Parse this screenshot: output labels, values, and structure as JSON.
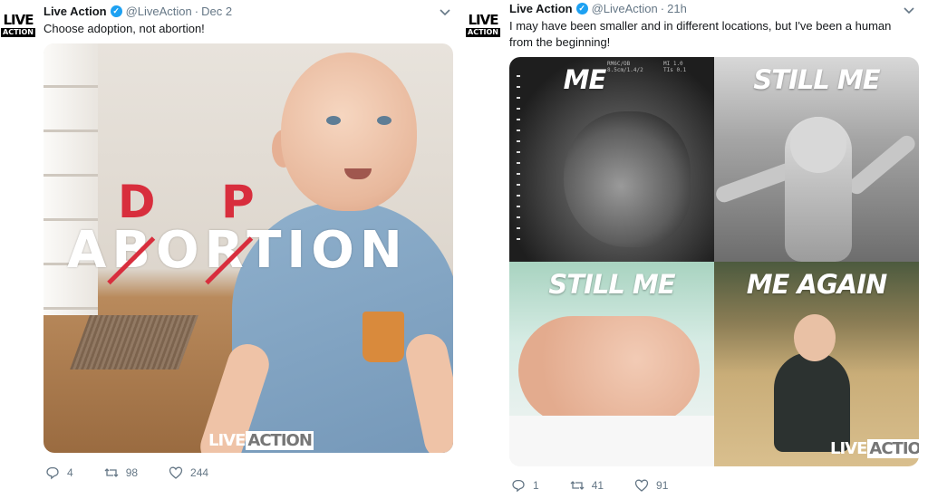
{
  "tweets": [
    {
      "avatar": {
        "line1": "LIVE",
        "line2": "ACTION"
      },
      "name": "Live Action",
      "handle": "@LiveAction",
      "time": "Dec 2",
      "text": "Choose adoption, not abortion!",
      "image": {
        "word": "ABORTION",
        "replacement_1": "D",
        "replacement_2": "P",
        "watermark_a": "LIVE",
        "watermark_b": "ACTION"
      },
      "replies": "4",
      "retweets": "98",
      "likes": "244"
    },
    {
      "avatar": {
        "line1": "LIVE",
        "line2": "ACTION"
      },
      "name": "Live Action",
      "handle": "@LiveAction",
      "time": "21h",
      "text": "I may have been smaller and in different locations, but I've been a human from the beginning!",
      "collage": {
        "panel_1": "ME",
        "panel_2": "STILL ME",
        "panel_3": "STILL ME",
        "panel_4": "ME AGAIN",
        "ultrasound_meta_left": "RM6C/OB",
        "ultrasound_meta_left_2": "8.5cm/1.4/2",
        "ultrasound_meta_right": "MI 1.0",
        "ultrasound_meta_right_2": "TIs 0.1",
        "watermark_a": "LIVE",
        "watermark_b": "ACTION"
      },
      "replies": "1",
      "retweets": "41",
      "likes": "91"
    }
  ],
  "colors": {
    "text": "#14171a",
    "secondary": "#657786",
    "verified": "#1da1f2",
    "overlay_red": "#d82e3d"
  },
  "icons": [
    "verified-badge-icon",
    "chevron-down-icon",
    "reply-icon",
    "retweet-icon",
    "like-icon"
  ]
}
